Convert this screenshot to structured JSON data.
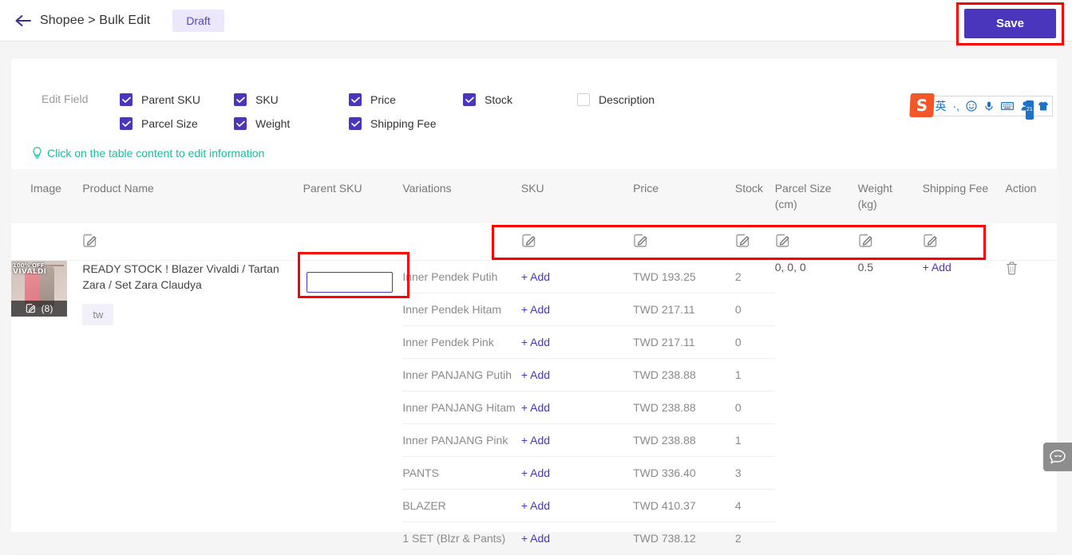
{
  "header": {
    "back_icon": "arrow-left-icon",
    "breadcrumb": "Shopee > Bulk Edit",
    "status_badge": "Draft",
    "save_label": "Save",
    "accent_color": "#4a35bd",
    "annotation_color": "#fe0000"
  },
  "edit_field": {
    "label": "Edit Field",
    "rows": [
      [
        {
          "label": "Parent SKU",
          "checked": true
        },
        {
          "label": "SKU",
          "checked": true
        },
        {
          "label": "Price",
          "checked": true
        },
        {
          "label": "Stock",
          "checked": true
        },
        {
          "label": "Description",
          "checked": false
        }
      ],
      [
        {
          "label": "Parcel Size",
          "checked": true
        },
        {
          "label": "Weight",
          "checked": true
        },
        {
          "label": "Shipping Fee",
          "checked": true
        }
      ]
    ]
  },
  "ime_toolbar": {
    "logo": "sogou-logo",
    "items": [
      {
        "name": "language-mode-icon",
        "glyph": "英"
      },
      {
        "name": "punctuation-mode-icon",
        "glyph": "·,"
      },
      {
        "name": "emoji-icon",
        "glyph": "☺"
      },
      {
        "name": "voice-input-icon",
        "glyph": "mic"
      },
      {
        "name": "soft-keyboard-icon",
        "glyph": "keyboard"
      },
      {
        "name": "user-center-icon",
        "glyph": "person",
        "badge": "21"
      },
      {
        "name": "skin-theme-icon",
        "glyph": "shirt"
      }
    ]
  },
  "hint": {
    "icon": "lightbulb-icon",
    "text": "Click on the table content to edit information",
    "color": "#1abc9c"
  },
  "table": {
    "columns": [
      "Image",
      "Product Name",
      "Parent SKU",
      "Variations",
      "SKU",
      "Price",
      "Stock",
      "Parcel Size (cm)",
      "Weight (kg)",
      "Shipping Fee",
      "Action"
    ],
    "batch_edit_row": {
      "icons": [
        {
          "column": "Product Name",
          "name": "edit-icon-product-name"
        },
        {
          "column": "SKU",
          "name": "edit-icon-sku"
        },
        {
          "column": "Price",
          "name": "edit-icon-price"
        },
        {
          "column": "Stock",
          "name": "edit-icon-stock"
        },
        {
          "column": "Parcel Size",
          "name": "edit-icon-parcel-size"
        },
        {
          "column": "Weight",
          "name": "edit-icon-weight"
        },
        {
          "column": "Shipping Fee",
          "name": "edit-icon-shipping-fee"
        }
      ]
    },
    "product": {
      "thumbnail": {
        "overlay_discount": "100% OFF",
        "overlay_brand": "VIVALDI",
        "image_count": "(8)",
        "edit_icon": "edit-icon"
      },
      "name": "READY STOCK ! Blazer Vivaldi / Tartan Zara / Set Zara Claudya",
      "tag": "tw",
      "parent_sku_value": "",
      "parent_sku_placeholder": "",
      "parcel_size": "0,  0,  0",
      "weight": "0.5",
      "shipping_fee": "+ Add",
      "delete_icon": "trash-icon",
      "variations": [
        {
          "name": "Inner Pendek Putih",
          "sku": "+ Add",
          "price": "TWD 193.25",
          "stock": "2"
        },
        {
          "name": "Inner Pendek Hitam",
          "sku": "+ Add",
          "price": "TWD 217.11",
          "stock": "0"
        },
        {
          "name": "Inner Pendek Pink",
          "sku": "+ Add",
          "price": "TWD 217.11",
          "stock": "0"
        },
        {
          "name": "Inner PANJANG Putih",
          "sku": "+ Add",
          "price": "TWD 238.88",
          "stock": "1"
        },
        {
          "name": "Inner PANJANG Hitam",
          "sku": "+ Add",
          "price": "TWD 238.88",
          "stock": "0"
        },
        {
          "name": "Inner PANJANG Pink",
          "sku": "+ Add",
          "price": "TWD 238.88",
          "stock": "1"
        },
        {
          "name": "PANTS",
          "sku": "+ Add",
          "price": "TWD 336.40",
          "stock": "3"
        },
        {
          "name": "BLAZER",
          "sku": "+ Add",
          "price": "TWD 410.37",
          "stock": "4"
        },
        {
          "name": "1 SET (Blzr & Pants)",
          "sku": "+ Add",
          "price": "TWD 738.12",
          "stock": "2"
        }
      ]
    }
  },
  "chat_widget": {
    "icon": "chat-bubble-icon"
  }
}
